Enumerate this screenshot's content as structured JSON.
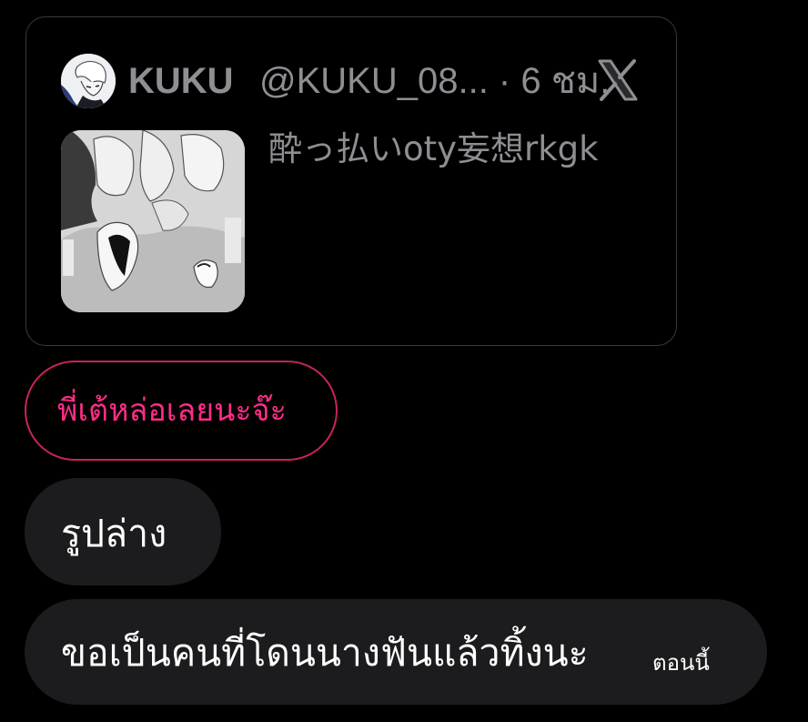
{
  "quoted_post": {
    "author_name": "KUKU",
    "author_meta": "@KUKU_08... · 6 ชม.",
    "platform_icon": "x-logo-icon",
    "text": "酔っ払いoty妄想rkgk",
    "thumbnail_icon": "manga-illustration-thumbnail"
  },
  "reply": {
    "text": "พี่เต้หล่อเลยนะจ๊ะ"
  },
  "messages": [
    {
      "text": "รูปล่าง",
      "time": ""
    },
    {
      "text": "ขอเป็นคนที่โดนนางฟันแล้วทิ้งนะ",
      "time": "ตอนนี้"
    }
  ],
  "colors": {
    "background": "#000000",
    "card_border": "#3a3a3c",
    "muted_text": "#8e8e93",
    "reply_accent": "#ff2d87",
    "reply_border": "#c8235f",
    "bubble": "#1c1c1e",
    "message_text": "#ffffff"
  }
}
